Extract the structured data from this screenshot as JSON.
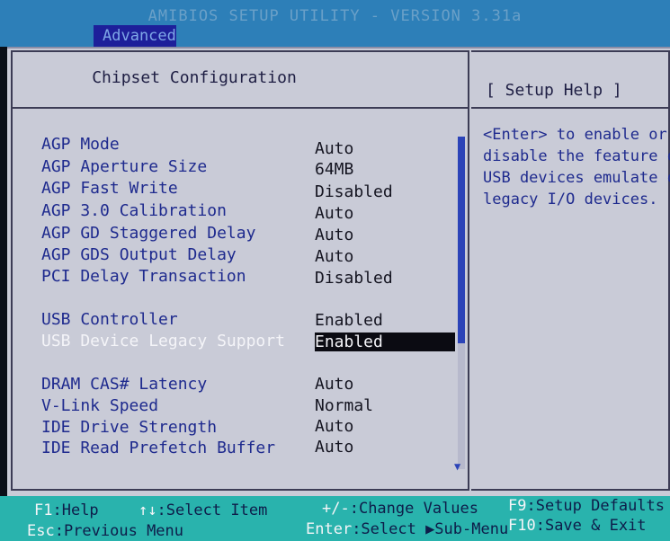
{
  "header": {
    "title": "AMIBIOS SETUP UTILITY - VERSION 3.31a",
    "active_tab": "Advanced"
  },
  "page": {
    "title": "Chipset Configuration",
    "help_title": "[ Setup Help ]",
    "help_lines": [
      "<Enter> to enable or",
      "disable the feature of",
      "USB devices emulate of",
      "legacy I/O devices."
    ]
  },
  "settings": [
    {
      "label": "AGP Mode",
      "value": "Auto"
    },
    {
      "label": "AGP Aperture Size",
      "value": "64MB"
    },
    {
      "label": "AGP Fast Write",
      "value": "Disabled"
    },
    {
      "label": "AGP 3.0 Calibration",
      "value": "Auto"
    },
    {
      "label": "AGP GD Staggered Delay",
      "value": "Auto"
    },
    {
      "label": "AGP GDS Output Delay",
      "value": "Auto"
    },
    {
      "label": "PCI Delay Transaction",
      "value": "Disabled"
    },
    {
      "label": "USB Controller",
      "value": "Enabled"
    },
    {
      "label": "USB Device Legacy Support",
      "value": "Enabled",
      "selected": true
    },
    {
      "label": "DRAM CAS# Latency",
      "value": "Auto"
    },
    {
      "label": "V-Link Speed",
      "value": "Normal"
    },
    {
      "label": "IDE Drive Strength",
      "value": "Auto"
    },
    {
      "label": "IDE Read Prefetch Buffer",
      "value": "Auto"
    }
  ],
  "footer": {
    "f1_key": "F1",
    "f1_text": ":Help",
    "arrows_key": "↑↓",
    "arrows_text": ":Select Item",
    "pm_key": "+/-",
    "pm_text": ":Change Values",
    "f9_key": "F9",
    "f9_text": ":Setup Defaults",
    "esc_key": "Esc",
    "esc_text": ":Previous Menu",
    "enter_key": "Enter",
    "enter_text": ":Select ▶Sub-Menu",
    "f10_key": "F10",
    "f10_text": ":Save & Exit"
  },
  "icons": {
    "scroll_down": "▼"
  },
  "colors": {
    "title_bar": "#2d7fb8",
    "active_tab": "#1d1f9a",
    "panel": "#c9cbd7",
    "option_text": "#1e2a8e",
    "footer": "#29b3ad",
    "selected_bg": "#0b0b12"
  }
}
